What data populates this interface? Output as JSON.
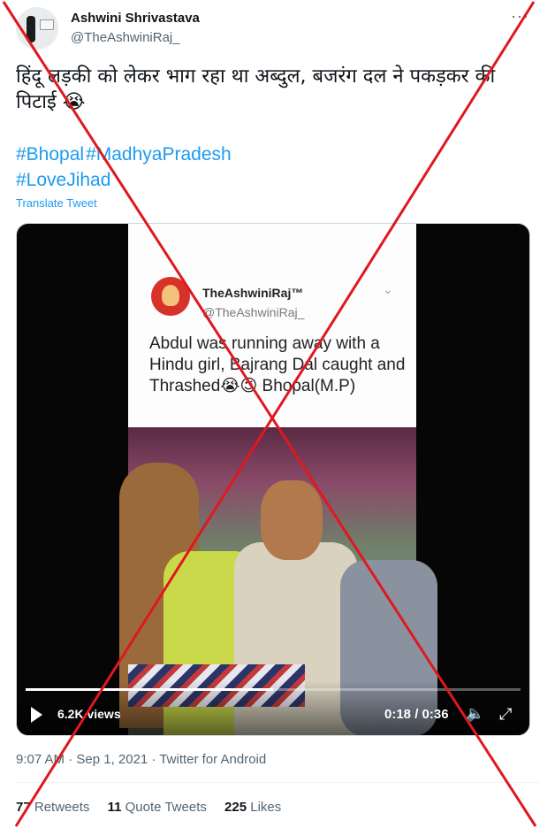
{
  "author": {
    "name": "Ashwini Shrivastava",
    "handle": "@TheAshwiniRaj_"
  },
  "more_icon": "···",
  "tweet": {
    "text": "हिंदू लड़की को लेकर भाग रहा था अब्दुल, बजरंग दल ने पकड़कर की पिटाई 😭",
    "hashtags": [
      "#Bhopal",
      "#MadhyaPradesh",
      "#LoveJihad"
    ],
    "translate_label": "Translate Tweet"
  },
  "video": {
    "embedded": {
      "name": "TheAshwiniRaj™",
      "handle": "@TheAshwiniRaj_",
      "chevron": "⌄",
      "text": "Abdul was running away with a Hindu girl, Bajrang Dal caught and Thrashed😭😉 Bhopal(M.P)"
    },
    "progress": 0.5,
    "views": "6.2K views",
    "time": "0:18 / 0:36",
    "volume_icon": "🔈",
    "fullscreen_icon": "⤢"
  },
  "meta": "9:07 AM · Sep 1, 2021 · Twitter for Android",
  "stats": {
    "retweets_count": "77",
    "retweets_label": "Retweets",
    "quotes_count": "11",
    "quotes_label": "Quote Tweets",
    "likes_count": "225",
    "likes_label": "Likes"
  },
  "overlay_color": "#e0181e"
}
